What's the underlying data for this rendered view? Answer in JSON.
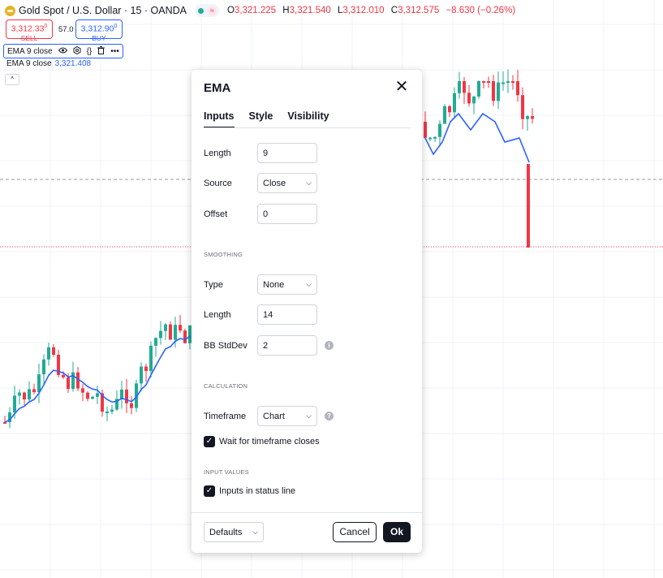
{
  "symbol": {
    "title": "Gold Spot / U.S. Dollar · 15 · OANDA",
    "wave_badge": "≈",
    "ohlc": [
      {
        "k": "O",
        "v": "3,321.225"
      },
      {
        "k": "H",
        "v": "3,321.540"
      },
      {
        "k": "L",
        "v": "3,312.010"
      },
      {
        "k": "C",
        "v": "3,312.575"
      }
    ],
    "change": "−8.630 (−0.26%)"
  },
  "trade": {
    "sell_price": "3,312.33",
    "sell_sup": "0",
    "sell_label": "SELL",
    "buy_price": "3,312.90",
    "buy_sup": "0",
    "buy_label": "BUY",
    "spread": "57.0"
  },
  "indicator": {
    "name": "EMA",
    "args": "9 close",
    "icons": [
      "eye-icon",
      "settings-icon",
      "source-code-icon",
      "trash-icon",
      "more-icon"
    ],
    "legend_value": "3,321.408",
    "collapse_glyph": "^"
  },
  "dialog": {
    "title": "EMA",
    "close_glyph": "✕",
    "tabs": [
      "Inputs",
      "Style",
      "Visibility"
    ],
    "inputs": {
      "length_label": "Length",
      "length_value": "9",
      "source_label": "Source",
      "source_value": "Close",
      "offset_label": "Offset",
      "offset_value": "0"
    },
    "smoothing": {
      "section": "SMOOTHING",
      "type_label": "Type",
      "type_value": "None",
      "length_label": "Length",
      "length_value": "14",
      "bb_label": "BB StdDev",
      "bb_value": "2"
    },
    "calculation": {
      "section": "CALCULATION",
      "timeframe_label": "Timeframe",
      "timeframe_value": "Chart",
      "wait_label": "Wait for timeframe closes"
    },
    "input_values": {
      "section": "INPUT VALUES",
      "status_label": "Inputs in status line"
    },
    "footer": {
      "defaults": "Defaults",
      "cancel": "Cancel",
      "ok": "Ok"
    }
  },
  "colors": {
    "bull": "#22ab94",
    "bear": "#f23645",
    "ema": "#2962ff",
    "ink": "#131722"
  }
}
